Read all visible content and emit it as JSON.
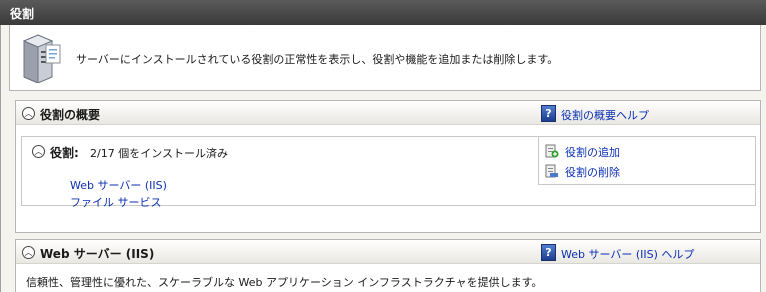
{
  "window": {
    "title": "役割"
  },
  "intro": {
    "icon": "server-icon",
    "text": "サーバーにインストールされている役割の正常性を表示し、役割や機能を追加または削除します。"
  },
  "roles_summary": {
    "title": "役割の概要",
    "help_link": "役割の概要ヘルプ",
    "roles_label": "役割:",
    "roles_status": "2/17 個をインストール済み",
    "installed_roles": [
      "Web サーバー (IIS)",
      "ファイル サービス"
    ],
    "actions": {
      "add": "役割の追加",
      "remove": "役割の削除"
    }
  },
  "web_server_section": {
    "title": "Web サーバー (IIS)",
    "help_link": "Web サーバー (IIS) ヘルプ",
    "description": "信頼性、管理性に優れた、スケーラブルな Web アプリケーション インフラストラクチャを提供します。"
  }
}
